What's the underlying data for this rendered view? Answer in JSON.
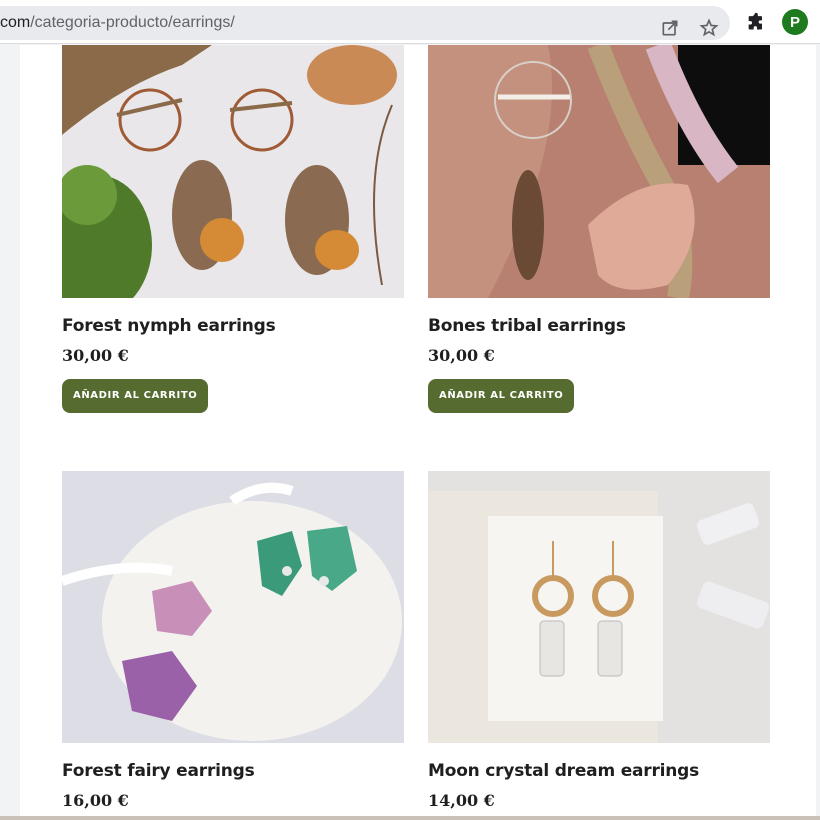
{
  "browser": {
    "url_host": "com",
    "url_path": "/categoria-producto/earrings/",
    "profile_initial": "P",
    "icons": [
      "share-icon",
      "star-icon",
      "extensions-icon"
    ]
  },
  "products": [
    {
      "name": "Forest nymph earrings",
      "price": "30,00 €",
      "button": "AÑADIR AL CARRITO"
    },
    {
      "name": "Bones tribal earrings",
      "price": "30,00 €",
      "button": "AÑADIR AL CARRITO"
    },
    {
      "name": "Forest fairy earrings",
      "price": "16,00 €"
    },
    {
      "name": "Moon crystal dream earrings",
      "price": "14,00 €"
    }
  ],
  "colors": {
    "button_bg": "#556b2f",
    "avatar_bg": "#1e7a1e"
  }
}
